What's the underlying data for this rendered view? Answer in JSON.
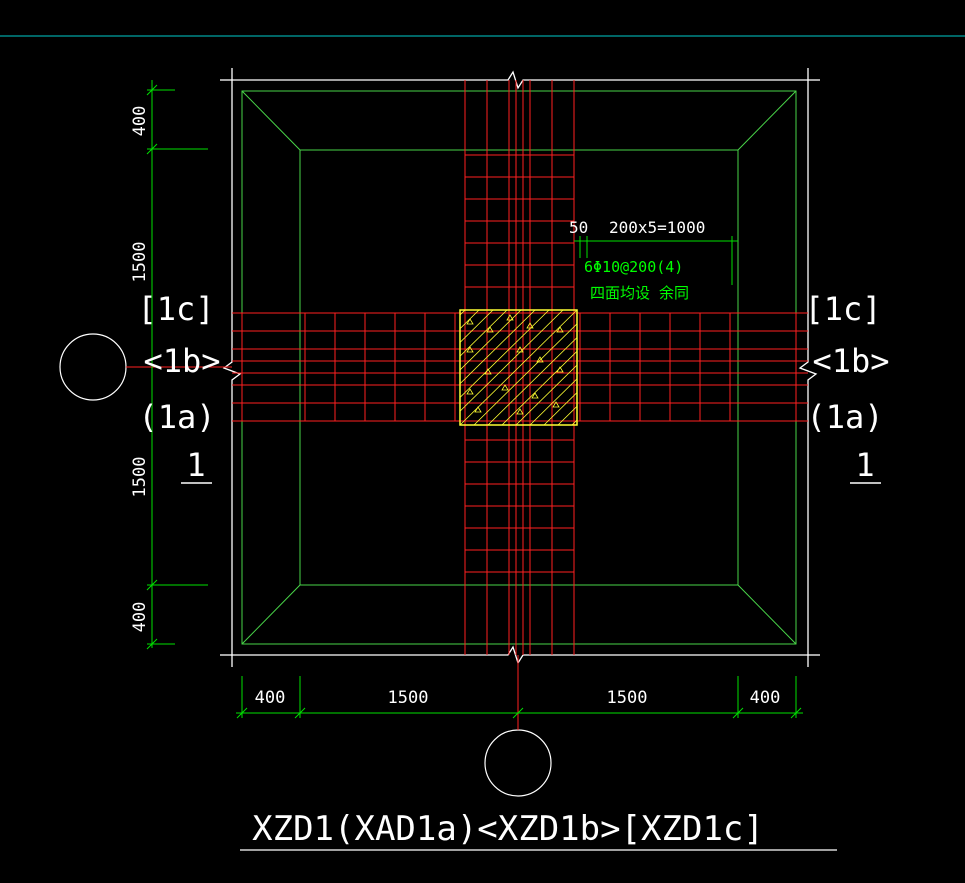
{
  "drawing": {
    "colors": {
      "background": "#000000",
      "outline": "#ffffff",
      "slope_lines": "#49d549",
      "rebar": "#ff2020",
      "column": "#ffff33",
      "dimension": "#00e000",
      "dimension_text": "#ffffff",
      "note_text": "#00ff00",
      "top_rule": "#00cccc"
    },
    "vertical_dims": [
      "400",
      "1500",
      "1500",
      "400"
    ],
    "horizontal_dims": [
      "400",
      "1500",
      "1500",
      "400"
    ],
    "left_labels": {
      "c": "[1c]",
      "b": "<1b>",
      "a": "(1a)",
      "section": "1"
    },
    "right_labels": {
      "c": "[1c]",
      "b": "<1b>",
      "a": "(1a)",
      "section": "1"
    },
    "rebar_spacing_dim": {
      "edge": "50",
      "spacing": "200x5=1000"
    },
    "rebar_note": {
      "line1": "6Φ10@200(4)",
      "line2": "四面均设 余同"
    },
    "title": "XZD1(XAD1a)<XZD1b>[XZD1c]"
  }
}
